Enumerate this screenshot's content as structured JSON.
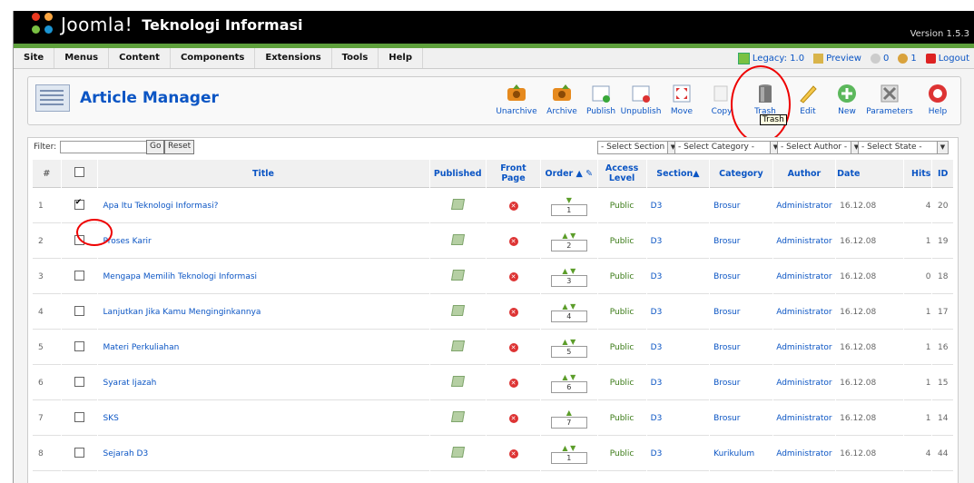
{
  "header": {
    "brand": "Joomla!",
    "site_name": "Teknologi Informasi",
    "version": "Version 1.5.3"
  },
  "menu": [
    "Site",
    "Menus",
    "Content",
    "Components",
    "Extensions",
    "Tools",
    "Help"
  ],
  "status": {
    "legacy": "Legacy: 1.0",
    "preview": "Preview",
    "messages": "0",
    "users": "1",
    "logout": "Logout"
  },
  "page": {
    "title": "Article Manager"
  },
  "toolbar": [
    {
      "label": "Unarchive",
      "icon": "unarchive-icon"
    },
    {
      "label": "Archive",
      "icon": "archive-icon"
    },
    {
      "label": "Publish",
      "icon": "publish-icon"
    },
    {
      "label": "Unpublish",
      "icon": "unpublish-icon"
    },
    {
      "label": "Move",
      "icon": "move-icon"
    },
    {
      "label": "Copy",
      "icon": "copy-icon"
    },
    {
      "label": "Trash",
      "icon": "trash-icon"
    },
    {
      "label": "Edit",
      "icon": "edit-icon"
    },
    {
      "label": "New",
      "icon": "new-icon"
    },
    {
      "label": "Parameters",
      "icon": "parameters-icon"
    },
    {
      "label": "Help",
      "icon": "help-icon"
    }
  ],
  "tooltip": "Trash",
  "filter": {
    "label": "Filter:",
    "go": "Go",
    "reset": "Reset",
    "section": "- Select Section -",
    "category": "- Select Category -",
    "author": "- Select Author -",
    "state": "- Select State -"
  },
  "columns": {
    "num": "#",
    "title": "Title",
    "published": "Published",
    "frontpage": "Front Page",
    "order": "Order",
    "access": "Access Level",
    "section": "Section",
    "category": "Category",
    "author": "Author",
    "date": "Date",
    "hits": "Hits",
    "id": "ID"
  },
  "rows": [
    {
      "num": "1",
      "title": "Apa Itu Teknologi Informasi?",
      "order": "1",
      "access": "Public",
      "section": "D3",
      "category": "Brosur",
      "author": "Administrator",
      "date": "16.12.08",
      "hits": "4",
      "id": "20",
      "checked": true
    },
    {
      "num": "2",
      "title": "Proses Karir",
      "order": "2",
      "access": "Public",
      "section": "D3",
      "category": "Brosur",
      "author": "Administrator",
      "date": "16.12.08",
      "hits": "1",
      "id": "19",
      "checked": false
    },
    {
      "num": "3",
      "title": "Mengapa Memilih Teknologi Informasi",
      "order": "3",
      "access": "Public",
      "section": "D3",
      "category": "Brosur",
      "author": "Administrator",
      "date": "16.12.08",
      "hits": "0",
      "id": "18",
      "checked": false
    },
    {
      "num": "4",
      "title": "Lanjutkan Jika Kamu Menginginkannya",
      "order": "4",
      "access": "Public",
      "section": "D3",
      "category": "Brosur",
      "author": "Administrator",
      "date": "16.12.08",
      "hits": "1",
      "id": "17",
      "checked": false
    },
    {
      "num": "5",
      "title": "Materi Perkuliahan",
      "order": "5",
      "access": "Public",
      "section": "D3",
      "category": "Brosur",
      "author": "Administrator",
      "date": "16.12.08",
      "hits": "1",
      "id": "16",
      "checked": false
    },
    {
      "num": "6",
      "title": "Syarat Ijazah",
      "order": "6",
      "access": "Public",
      "section": "D3",
      "category": "Brosur",
      "author": "Administrator",
      "date": "16.12.08",
      "hits": "1",
      "id": "15",
      "checked": false
    },
    {
      "num": "7",
      "title": "SKS",
      "order": "7",
      "access": "Public",
      "section": "D3",
      "category": "Brosur",
      "author": "Administrator",
      "date": "16.12.08",
      "hits": "1",
      "id": "14",
      "checked": false
    },
    {
      "num": "8",
      "title": "Sejarah D3",
      "order": "1",
      "access": "Public",
      "section": "D3",
      "category": "Kurikulum",
      "author": "Administrator",
      "date": "16.12.08",
      "hits": "4",
      "id": "44",
      "checked": false
    }
  ]
}
